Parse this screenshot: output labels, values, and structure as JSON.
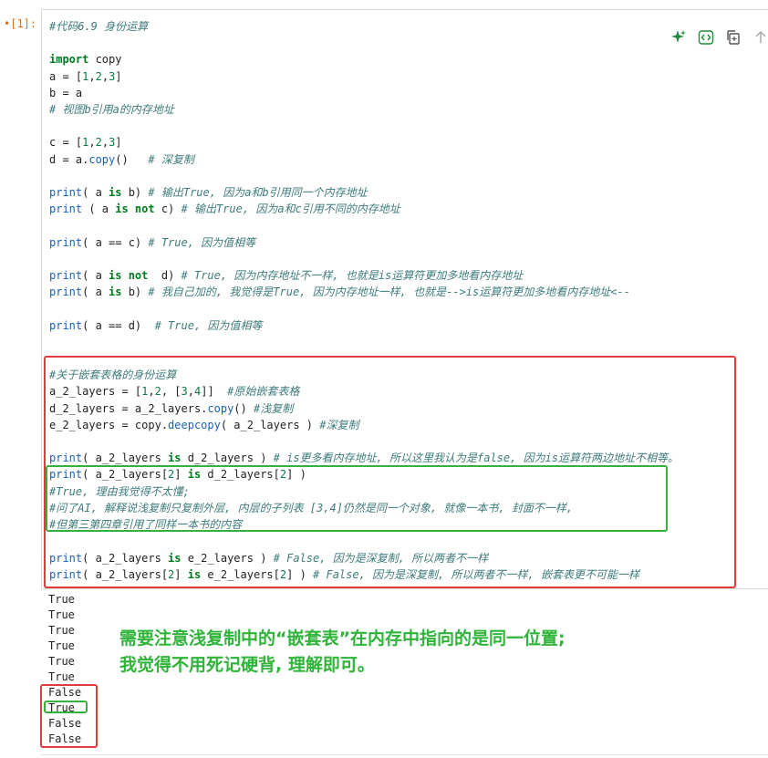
{
  "cell": {
    "prompt": "•[1]:",
    "toolbar": {
      "icons": [
        "sparkle-icon",
        "code-icon",
        "copy-icon",
        "arrow-up-icon",
        "arrow-down-icon"
      ]
    }
  },
  "code": {
    "lines": [
      "#代码6.9 身份运算",
      "",
      "import copy",
      "a = [1,2,3]",
      "b = a",
      "# 视图b引用a的内存地址",
      "",
      "c = [1,2,3]",
      "d = a.copy()   # 深复制",
      "",
      "print( a is b) # 输出True, 因为a和b引用同一个内存地址",
      "print ( a is not c) # 输出True, 因为a和c引用不同的内存地址",
      "",
      "print( a == c) # True, 因为值相等",
      "",
      "print( a is not  d) # True, 因为内存地址不一样, 也就是is运算符更加多地看内存地址",
      "print( a is b) # 我自己加的, 我觉得是True, 因为内存地址一样, 也就是-->is运算符更加多地看内存地址<--",
      "",
      "print( a == d)  # True, 因为值相等",
      "",
      "",
      "#关于嵌套表格的身份运算",
      "a_2_layers = [1,2, [3,4]]  #原始嵌套表格",
      "d_2_layers = a_2_layers.copy() #浅复制",
      "e_2_layers = copy.deepcopy( a_2_layers ) #深复制",
      "",
      "print( a_2_layers is d_2_layers ) # is更多看内存地址, 所以这里我认为是false, 因为is运算符两边地址不相等。",
      "print( a_2_layers[2] is d_2_layers[2] )",
      "#True, 理由我觉得不太懂;",
      "#问了AI, 解释说浅复制只复制外层, 内层的子列表 [3,4]仍然是同一个对象, 就像一本书, 封面不一样,",
      "#但第三第四章引用了同样一本书的内容",
      "",
      "print( a_2_layers is e_2_layers ) # False, 因为是深复制, 所以两者不一样",
      "print( a_2_layers[2] is e_2_layers[2] ) # False, 因为是深复制, 所以两者不一样, 嵌套表更不可能一样"
    ]
  },
  "output": {
    "lines": [
      "True",
      "True",
      "True",
      "True",
      "True",
      "True",
      "False",
      "True",
      "False",
      "False"
    ]
  },
  "annotation": {
    "line1": "需要注意浅复制中的“嵌套表”在内存中指向的是同一位置;",
    "line2": "我觉得不用死记硬背, 理解即可。"
  },
  "colors": {
    "prompt": "#d4761a",
    "comment": "#3d7a7a",
    "keyword": "#007a1f",
    "highlight_red": "#e23b3b",
    "highlight_green": "#33b33d",
    "annotation": "#2fb43a"
  }
}
